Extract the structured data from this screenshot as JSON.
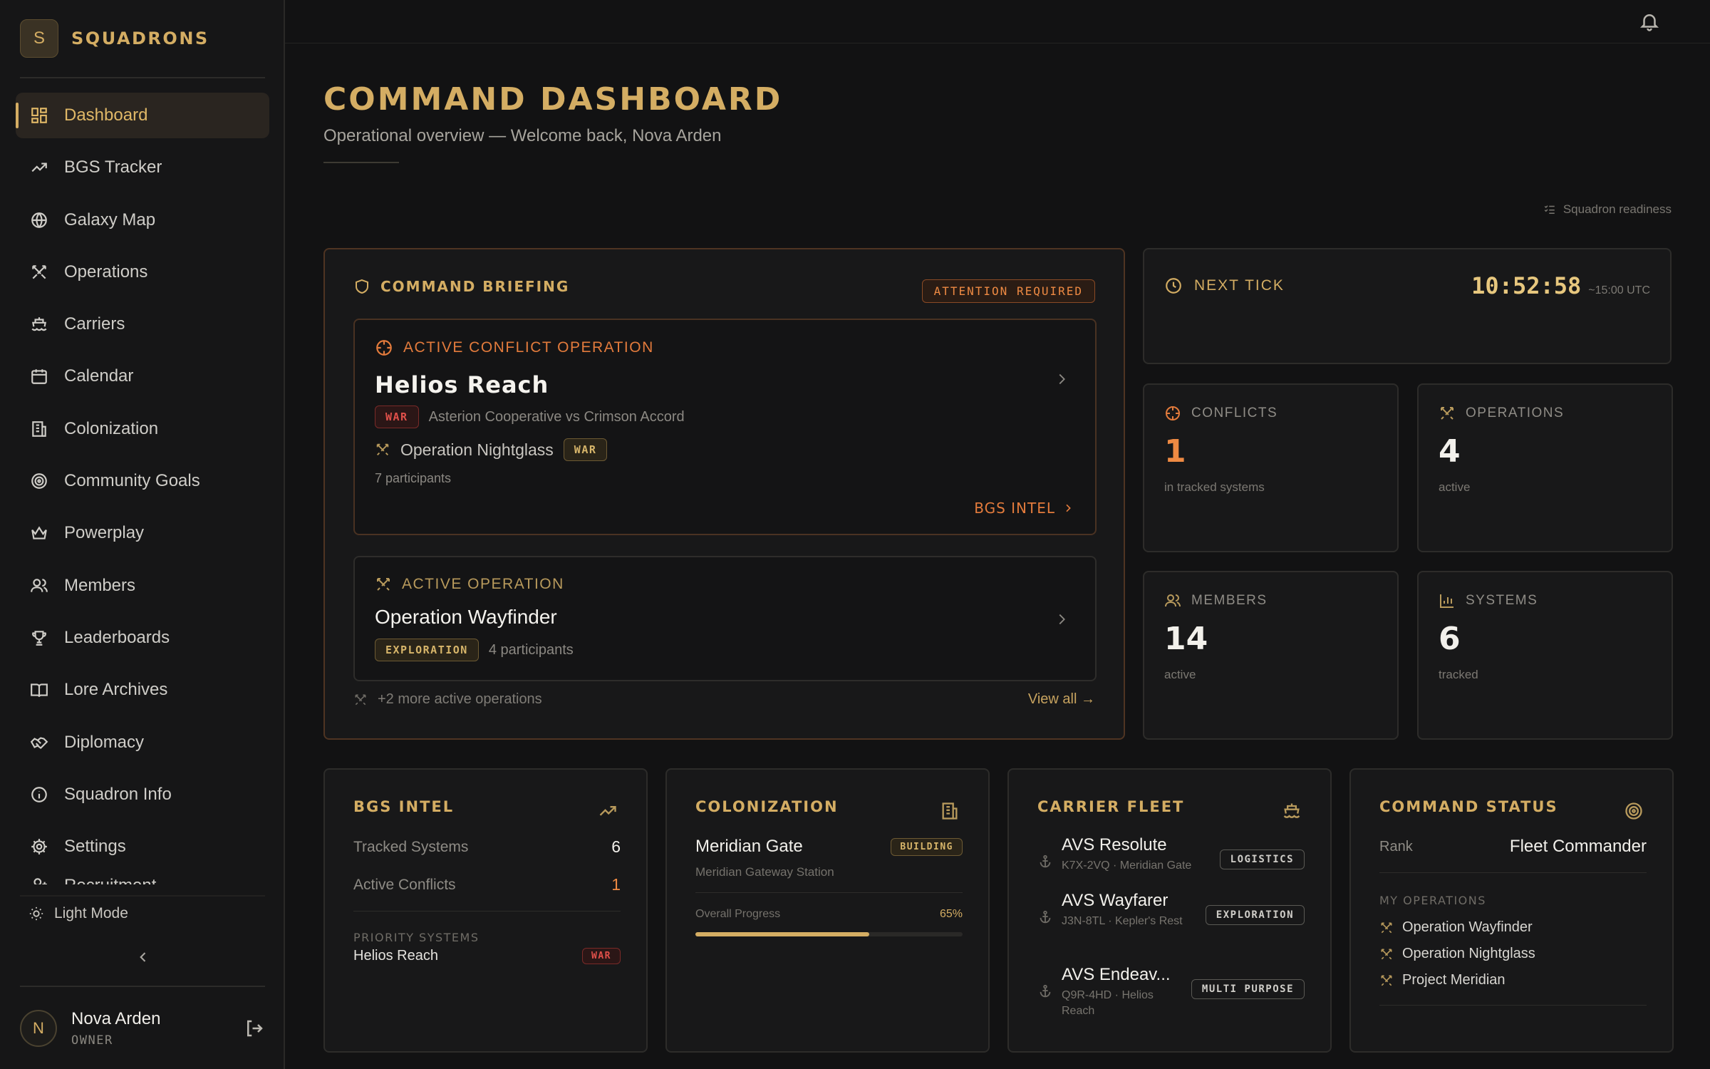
{
  "brand": {
    "initial": "S",
    "name": "SQUADRONS"
  },
  "nav": {
    "items": [
      {
        "label": "Dashboard",
        "icon": "grid-icon",
        "active": true
      },
      {
        "label": "BGS Tracker",
        "icon": "trend-icon"
      },
      {
        "label": "Galaxy Map",
        "icon": "globe-icon"
      },
      {
        "label": "Operations",
        "icon": "crossed-swords-icon"
      },
      {
        "label": "Carriers",
        "icon": "ship-icon"
      },
      {
        "label": "Calendar",
        "icon": "calendar-icon"
      },
      {
        "label": "Colonization",
        "icon": "building-icon"
      },
      {
        "label": "Community Goals",
        "icon": "target-icon"
      },
      {
        "label": "Powerplay",
        "icon": "crown-icon"
      },
      {
        "label": "Members",
        "icon": "users-icon"
      },
      {
        "label": "Leaderboards",
        "icon": "trophy-icon"
      },
      {
        "label": "Lore Archives",
        "icon": "book-icon"
      },
      {
        "label": "Diplomacy",
        "icon": "handshake-icon"
      },
      {
        "label": "Squadron Info",
        "icon": "info-icon"
      },
      {
        "label": "Settings",
        "icon": "gear-icon"
      },
      {
        "label": "Recruitment",
        "icon": "user-plus-icon"
      }
    ],
    "light_mode": "Light Mode"
  },
  "user": {
    "initial": "N",
    "name": "Nova Arden",
    "role": "OWNER"
  },
  "header": {
    "title": "COMMAND DASHBOARD",
    "subtitle": "Operational overview — Welcome back, Nova Arden",
    "readiness": "Squadron readiness"
  },
  "briefing": {
    "title": "COMMAND BRIEFING",
    "badge": "ATTENTION REQUIRED",
    "conflict": {
      "kicker": "ACTIVE CONFLICT OPERATION",
      "title": "Helios Reach",
      "tag": "WAR",
      "factions": "Asterion Cooperative vs Crimson Accord",
      "operation": "Operation Nightglass",
      "operation_tag": "WAR",
      "participants": "7 participants",
      "link": "BGS INTEL"
    },
    "operation": {
      "kicker": "ACTIVE OPERATION",
      "title": "Operation Wayfinder",
      "tag": "EXPLORATION",
      "participants": "4 participants"
    },
    "more": "+2 more active operations",
    "view_all": "View all →"
  },
  "tick": {
    "label": "NEXT TICK",
    "time": "10:52:58",
    "utc": "~15:00 UTC"
  },
  "stats": {
    "conflicts": {
      "label": "CONFLICTS",
      "value": "1",
      "desc": "in tracked systems"
    },
    "operations": {
      "label": "OPERATIONS",
      "value": "4",
      "desc": "active"
    },
    "members": {
      "label": "MEMBERS",
      "value": "14",
      "desc": "active"
    },
    "systems": {
      "label": "SYSTEMS",
      "value": "6",
      "desc": "tracked"
    }
  },
  "bgs": {
    "title": "BGS INTEL",
    "tracked_label": "Tracked Systems",
    "tracked_value": "6",
    "conflicts_label": "Active Conflicts",
    "conflicts_value": "1",
    "priority_label": "PRIORITY SYSTEMS",
    "priority_system": "Helios Reach",
    "priority_tag": "WAR"
  },
  "colonization": {
    "title": "COLONIZATION",
    "name": "Meridian Gate",
    "tag": "BUILDING",
    "station": "Meridian Gateway Station",
    "progress_label": "Overall Progress",
    "progress_text": "65%",
    "progress": 0.65
  },
  "fleet": {
    "title": "CARRIER FLEET",
    "carriers": [
      {
        "name": "AVS Resolute",
        "sub": "K7X-2VQ · Meridian Gate",
        "tag": "LOGISTICS"
      },
      {
        "name": "AVS Wayfarer",
        "sub": "J3N-8TL · Kepler's Rest",
        "tag": "EXPLORATION"
      },
      {
        "name": "AVS Endeav...",
        "sub": "Q9R-4HD · Helios Reach",
        "tag": "MULTI PURPOSE"
      }
    ]
  },
  "command": {
    "title": "COMMAND STATUS",
    "rank_label": "Rank",
    "rank": "Fleet Commander",
    "ops_label": "MY OPERATIONS",
    "ops": [
      "Operation Wayfinder",
      "Operation Nightglass",
      "Project Meridian"
    ]
  },
  "colors": {
    "accent": "#d4ad63",
    "conflict": "#ee8a43",
    "war": "#e0504a"
  }
}
